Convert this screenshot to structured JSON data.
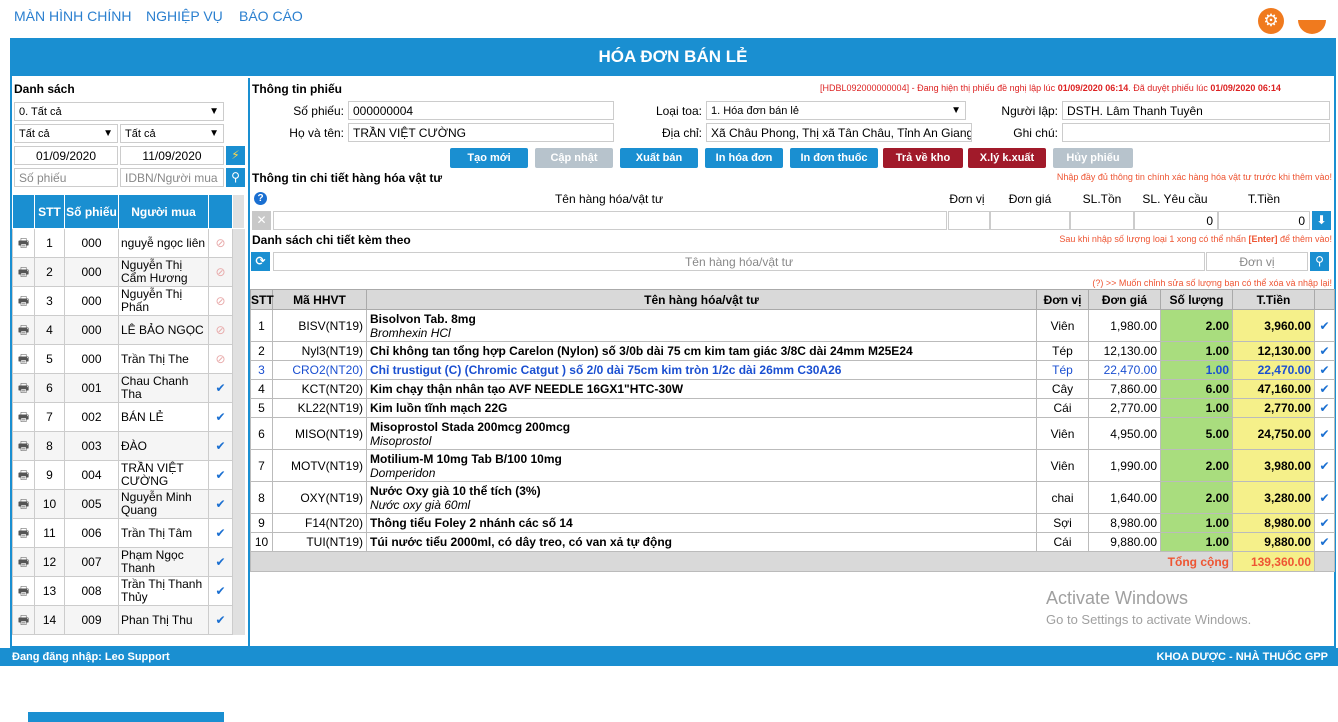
{
  "nav": {
    "home": "MÀN HÌNH CHÍNH",
    "ops": "NGHIỆP VỤ",
    "report": "BÁO CÁO"
  },
  "title": "HÓA ĐƠN BÁN LẺ",
  "left": {
    "heading": "Danh sách",
    "filter_all": "0. Tất cả",
    "filter_a": "Tất cả",
    "filter_b": "Tất cả",
    "date_from": "01/09/2020",
    "date_to": "11/09/2020",
    "ph_so_phieu": "Số phiếu",
    "ph_buyer": "IDBN/Người mua",
    "cols": {
      "stt": "STT",
      "so": "Số phiếu",
      "buyer": "Người mua"
    },
    "rows": [
      {
        "stt": "1",
        "so": "000",
        "name": "nguyễ ngọc liên",
        "s": "x"
      },
      {
        "stt": "2",
        "so": "000",
        "name": "Nguyễn Thị Cẩm Hương",
        "s": "x"
      },
      {
        "stt": "3",
        "so": "000",
        "name": "Nguyễn Thị Phấn",
        "s": "x"
      },
      {
        "stt": "4",
        "so": "000",
        "name": "LÊ BẢO NGỌC",
        "s": "x"
      },
      {
        "stt": "5",
        "so": "000",
        "name": "Trần Thị The",
        "s": "x"
      },
      {
        "stt": "6",
        "so": "001",
        "name": "Chau Chanh Tha",
        "s": "c"
      },
      {
        "stt": "7",
        "so": "002",
        "name": "BÁN LẺ",
        "s": "c"
      },
      {
        "stt": "8",
        "so": "003",
        "name": "ĐÀO",
        "s": "c"
      },
      {
        "stt": "9",
        "so": "004",
        "name": "TRẦN VIỆT CƯỜNG",
        "s": "c"
      },
      {
        "stt": "10",
        "so": "005",
        "name": "Nguyễn Minh Quang",
        "s": "c"
      },
      {
        "stt": "11",
        "so": "006",
        "name": "Trần Thị Tâm",
        "s": "c"
      },
      {
        "stt": "12",
        "so": "007",
        "name": "Phạm Ngọc Thanh",
        "s": "c"
      },
      {
        "stt": "13",
        "so": "008",
        "name": "Trần Thị Thanh Thủy",
        "s": "c"
      },
      {
        "stt": "14",
        "so": "009",
        "name": "Phan Thị Thu",
        "s": "c"
      }
    ]
  },
  "info": {
    "heading": "Thông tin phiếu",
    "notice_code": "[HDBL092000000004]",
    "notice_mid": " - Đang hiện thị phiếu đề nghị lập lúc ",
    "notice_t1": "01/09/2020 06:14",
    "notice_mid2": ". Đã duyệt phiếu lúc ",
    "notice_t2": "01/09/2020 06:14",
    "so_phieu_lbl": "Số phiếu:",
    "so_phieu": "000000004",
    "ho_ten_lbl": "Họ và tên:",
    "ho_ten": "TRẦN VIỆT CƯỜNG",
    "loai_toa_lbl": "Loại toa:",
    "loai_toa": "1. Hóa đơn bán lẻ",
    "dia_chi_lbl": "Địa chỉ:",
    "dia_chi": "Xã Châu Phong, Thị xã Tân Châu, Tỉnh An Giang",
    "nguoi_lap_lbl": "Người lập:",
    "nguoi_lap": "DSTH. Lâm Thanh Tuyên",
    "ghi_chu_lbl": "Ghi chú:"
  },
  "buttons": {
    "tao_moi": "Tạo mới",
    "cap_nhat": "Cập nhật",
    "xuat_ban": "Xuất bán",
    "in_hoa_don": "In hóa đơn",
    "in_don_thuoc": "In đơn thuốc",
    "tra_ve_kho": "Trả về kho",
    "xly": "X.lý k.xuất",
    "huy": "Hủy phiếu"
  },
  "detail": {
    "heading": "Thông tin chi tiết hàng hóa vật tư",
    "warn": "Nhập đầy đủ thông tin chính xác hàng hóa vật tư trước khi thêm vào!",
    "col_name": "Tên hàng hóa/vật tư",
    "col_unit": "Đơn vị",
    "col_price": "Đơn giá",
    "col_stock": "SL.Tồn",
    "col_req": "SL. Yêu cầu",
    "col_total": "T.Tiền",
    "req_val": "0",
    "total_val": "0"
  },
  "list": {
    "heading": "Danh sách chi tiết kèm theo",
    "hint_a": "Sau khi nhập số lượng loại 1 xong có thể nhấn ",
    "hint_key": "[Enter]",
    "hint_b": " để thêm vào!",
    "ph_name": "Tên hàng hóa/vật tư",
    "ph_unit": "Đơn vị",
    "edit_hint": "(?) >> Muốn chỉnh sửa số lượng bạn có thể xóa và nhập lại!"
  },
  "table": {
    "cols": {
      "stt": "STT",
      "code": "Mã HHVT",
      "name": "Tên hàng hóa/vật tư",
      "unit": "Đơn vị",
      "price": "Đơn giá",
      "qty": "Số lượng",
      "total": "T.Tiền"
    },
    "rows": [
      {
        "stt": "1",
        "code": "BISV(NT19)",
        "name": "Bisolvon Tab. 8mg",
        "sub": "Bromhexin HCl",
        "unit": "Viên",
        "price": "1,980.00",
        "qty": "2.00",
        "total": "3,960.00"
      },
      {
        "stt": "2",
        "code": "Nyl3(NT19)",
        "name": "Chỉ không tan tổng hợp Carelon (Nylon) số 3/0b dài 75 cm kim tam giác 3/8C dài 24mm M25E24",
        "sub": "",
        "unit": "Tép",
        "price": "12,130.00",
        "qty": "1.00",
        "total": "12,130.00"
      },
      {
        "stt": "3",
        "code": "CRO2(NT20)",
        "name": "Chỉ trustigut (C) (Chromic Catgut ) số 2/0 dài 75cm kim tròn 1/2c dài 26mm C30A26",
        "sub": "",
        "unit": "Tép",
        "price": "22,470.00",
        "qty": "1.00",
        "total": "22,470.00",
        "blue": true
      },
      {
        "stt": "4",
        "code": "KCT(NT20)",
        "name": "Kim chạy thận nhân tạo AVF NEEDLE 16GX1\"HTC-30W",
        "sub": "",
        "unit": "Cây",
        "price": "7,860.00",
        "qty": "6.00",
        "total": "47,160.00"
      },
      {
        "stt": "5",
        "code": "KL22(NT19)",
        "name": "Kim luồn tĩnh mạch 22G",
        "sub": "",
        "unit": "Cái",
        "price": "2,770.00",
        "qty": "1.00",
        "total": "2,770.00"
      },
      {
        "stt": "6",
        "code": "MISO(NT19)",
        "name": "Misoprostol Stada 200mcg 200mcg",
        "sub": "Misoprostol",
        "unit": "Viên",
        "price": "4,950.00",
        "qty": "5.00",
        "total": "24,750.00"
      },
      {
        "stt": "7",
        "code": "MOTV(NT19)",
        "name": "Motilium-M 10mg Tab B/100 10mg",
        "sub": "Domperidon",
        "unit": "Viên",
        "price": "1,990.00",
        "qty": "2.00",
        "total": "3,980.00"
      },
      {
        "stt": "8",
        "code": "OXY(NT19)",
        "name": "Nước Oxy già 10 thể tích (3%)",
        "sub": "Nước oxy già 60ml",
        "unit": "chai",
        "price": "1,640.00",
        "qty": "2.00",
        "total": "3,280.00"
      },
      {
        "stt": "9",
        "code": "F14(NT20)",
        "name": "Thông tiểu Foley 2 nhánh các số 14",
        "sub": "",
        "unit": "Sợi",
        "price": "8,980.00",
        "qty": "1.00",
        "total": "8,980.00"
      },
      {
        "stt": "10",
        "code": "TUI(NT19)",
        "name": "Túi nước tiểu 2000ml, có dây treo, có van xả tự động",
        "sub": "",
        "unit": "Cái",
        "price": "9,880.00",
        "qty": "1.00",
        "total": "9,880.00"
      }
    ],
    "total_label": "Tổng cộng",
    "total_value": "139,360.00"
  },
  "status": {
    "login": "Đang đăng nhập: Leo Support",
    "dept": "KHOA DƯỢC - NHÀ THUỐC GPP"
  },
  "watermark": {
    "l1": "Activate Windows",
    "l2": "Go to Settings to activate Windows."
  }
}
